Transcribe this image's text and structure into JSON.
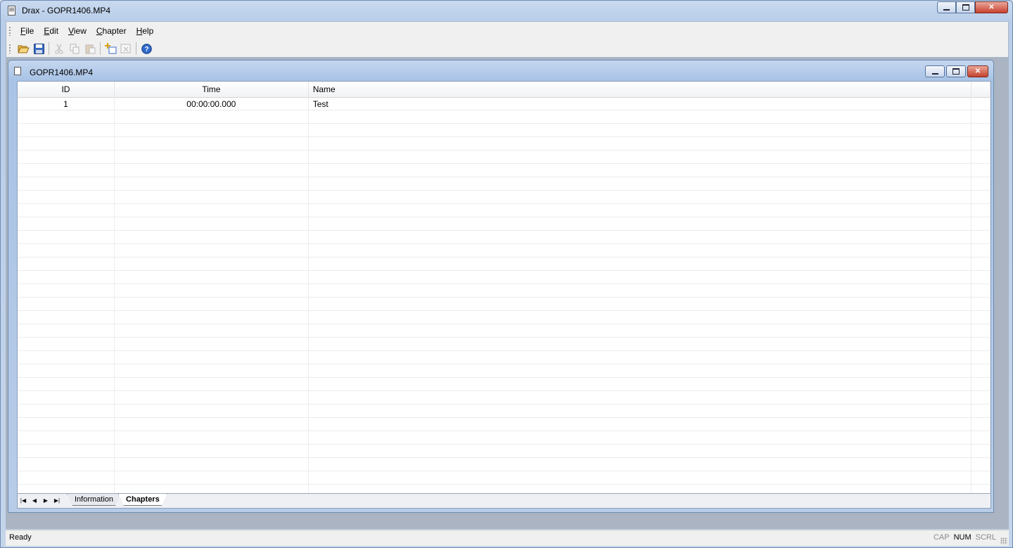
{
  "app": {
    "title": "Drax - GOPR1406.MP4"
  },
  "menu": {
    "items": [
      {
        "accel": "F",
        "rest": "ile"
      },
      {
        "accel": "E",
        "rest": "dit"
      },
      {
        "accel": "V",
        "rest": "iew"
      },
      {
        "accel": "C",
        "rest": "hapter"
      },
      {
        "accel": "H",
        "rest": "elp"
      }
    ]
  },
  "toolbar": {
    "buttons": [
      {
        "icon": "open-folder-icon",
        "enabled": true
      },
      {
        "icon": "save-icon",
        "enabled": true
      },
      {
        "icon": "cut-icon",
        "enabled": false
      },
      {
        "icon": "copy-icon",
        "enabled": false
      },
      {
        "icon": "paste-icon",
        "enabled": false
      },
      {
        "icon": "add-chapter-icon",
        "enabled": true
      },
      {
        "icon": "remove-chapter-icon",
        "enabled": false
      },
      {
        "icon": "help-icon",
        "enabled": true
      }
    ]
  },
  "document": {
    "title": "GOPR1406.MP4",
    "columns": {
      "id": "ID",
      "time": "Time",
      "name": "Name"
    },
    "rows": [
      {
        "id": "1",
        "time": "00:00:00.000",
        "name": "Test"
      }
    ],
    "tabs": {
      "information": "Information",
      "chapters": "Chapters",
      "active": "Chapters"
    }
  },
  "status": {
    "text": "Ready",
    "cap": "CAP",
    "num": "NUM",
    "scrl": "SCRL"
  },
  "colors": {
    "accent": "#4a6fa5",
    "close_red": "#c9412d"
  }
}
